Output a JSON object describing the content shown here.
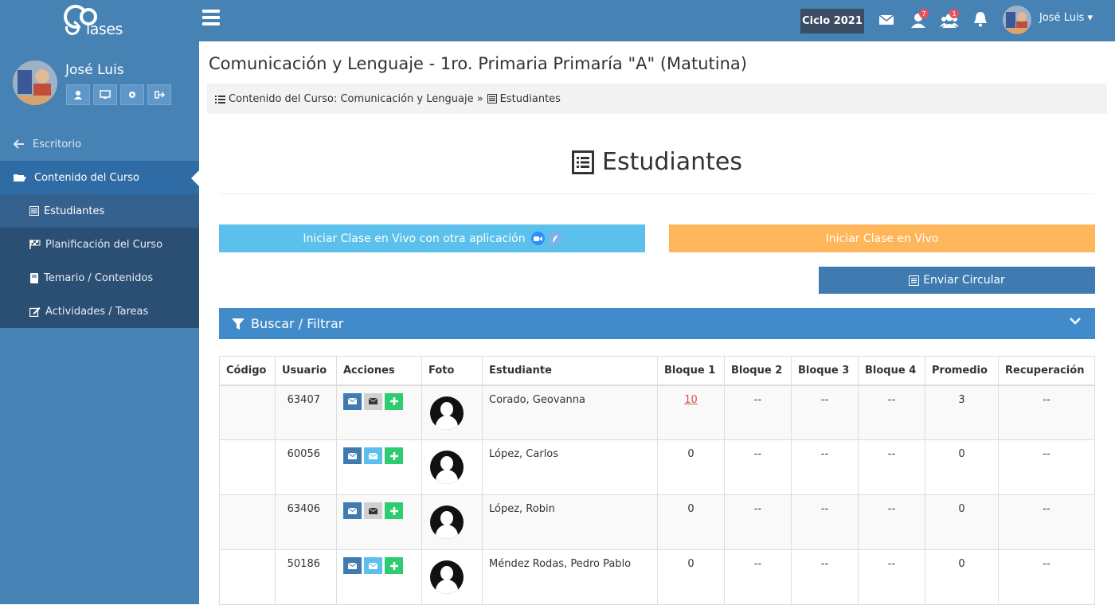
{
  "topbar": {
    "logo_text": "lases",
    "ciclo_label": "Ciclo 2021",
    "icons": [
      {
        "name": "envelope-icon",
        "badge": ""
      },
      {
        "name": "user-icon",
        "badge": "7"
      },
      {
        "name": "users-icon",
        "badge": "1"
      },
      {
        "name": "bell-icon",
        "badge": ""
      }
    ],
    "user_name": "José Luis"
  },
  "sidebar": {
    "user_name": "José Luis",
    "menu": {
      "escritorio": "Escritorio",
      "contenido": "Contenido del Curso",
      "estudiantes": "Estudiantes",
      "planificacion": "Planificación del Curso",
      "temario": "Temario / Contenidos",
      "actividades": "Actividades / Tareas"
    }
  },
  "main": {
    "title": "Comunicación y Lenguaje - 1ro. Primaria Primaría \"A\" (Matutina)",
    "breadcrumb": {
      "first": "Contenido del Curso: Comunicación y Lenguaje »",
      "second": "Estudiantes"
    },
    "heading": "Estudiantes",
    "btn_vivo_otra": "Iniciar Clase en Vivo con otra aplicación",
    "btn_vivo": "Iniciar Clase en Vivo",
    "btn_circular": "Enviar Circular",
    "filter_label": "Buscar / Filtrar"
  },
  "table": {
    "headers": [
      "Código",
      "Usuario",
      "Acciones",
      "Foto",
      "Estudiante",
      "Bloque 1",
      "Bloque 2",
      "Bloque 3",
      "Bloque 4",
      "Promedio",
      "Recuperación"
    ],
    "rows": [
      {
        "codigo": "",
        "usuario": "63407",
        "estudiante": "Corado, Geovanna",
        "b1": "10",
        "b2": "--",
        "b3": "--",
        "b4": "--",
        "promedio": "3",
        "recuperacion": "--"
      },
      {
        "codigo": "",
        "usuario": "60056",
        "estudiante": "López, Carlos",
        "b1": "0",
        "b2": "--",
        "b3": "--",
        "b4": "--",
        "promedio": "0",
        "recuperacion": "--"
      },
      {
        "codigo": "",
        "usuario": "63406",
        "estudiante": "López, Robin",
        "b1": "0",
        "b2": "--",
        "b3": "--",
        "b4": "--",
        "promedio": "0",
        "recuperacion": "--"
      },
      {
        "codigo": "",
        "usuario": "50186",
        "estudiante": "Méndez Rodas, Pedro Pablo",
        "b1": "0",
        "b2": "--",
        "b3": "--",
        "b4": "--",
        "promedio": "0",
        "recuperacion": "--"
      }
    ]
  },
  "colors": {
    "primary": "#4682b4",
    "sidebar_sub": "#2b4f73",
    "btn_info": "#5bc0eb",
    "btn_warning": "#ffb65a",
    "btn_circular": "#3f7ab1",
    "filter": "#428bca"
  }
}
